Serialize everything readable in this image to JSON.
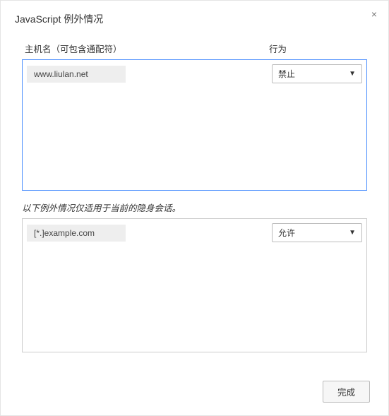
{
  "dialog": {
    "title": "JavaScript 例外情况",
    "close_label": "×"
  },
  "headers": {
    "host": "主机名（可包含通配符）",
    "action": "行为"
  },
  "exceptions": [
    {
      "host": "www.liulan.net",
      "action": "禁止"
    }
  ],
  "incognito_note": "以下例外情况仅适用于当前的隐身会话。",
  "incognito_exceptions": [
    {
      "host": "[*.]example.com",
      "action": "允许"
    }
  ],
  "footer": {
    "done_label": "完成"
  }
}
